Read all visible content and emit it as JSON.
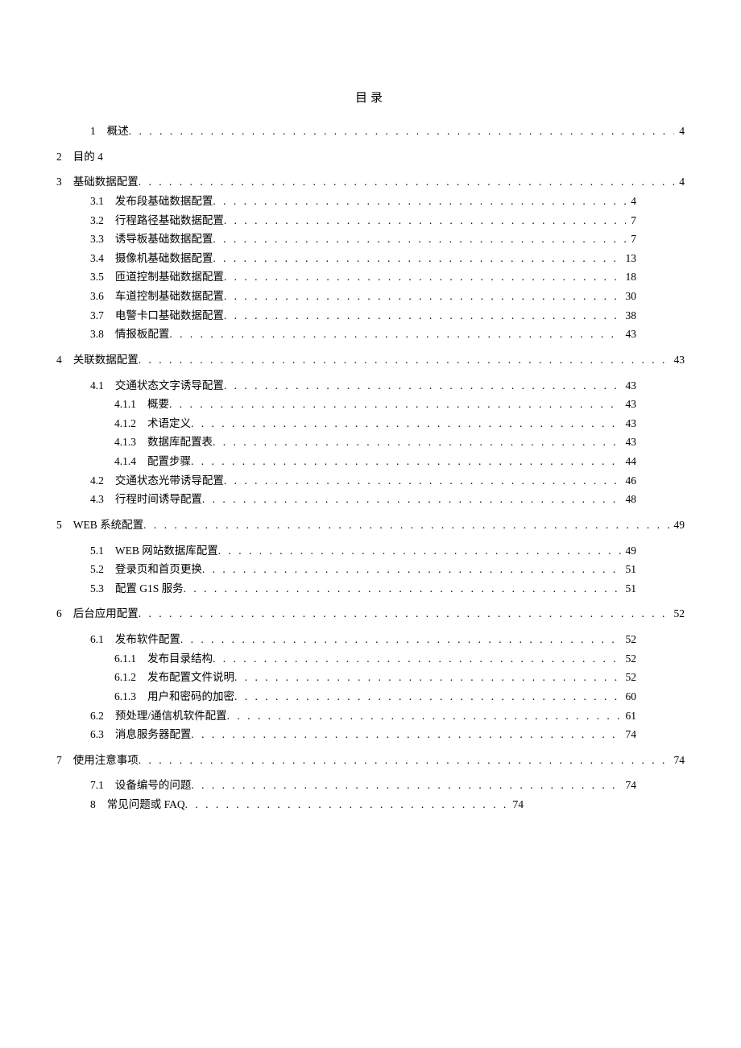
{
  "title": "目录",
  "toc": [
    {
      "num": "1",
      "text": "概述",
      "page": "4",
      "indent": 1,
      "rmargin": 0
    },
    {
      "num": "2",
      "text": "目的 4",
      "page": "",
      "indent": 0,
      "rmargin": 0,
      "nodots": true,
      "spacer_before": true
    },
    {
      "num": "3",
      "text": "基础数据配置",
      "page": "4",
      "indent": 0,
      "rmargin": 0,
      "spacer_before": true
    },
    {
      "num": "3.1",
      "text": "发布段基础数据配置",
      "page": "4",
      "indent": 2,
      "rmargin": 60
    },
    {
      "num": "3.2",
      "text": "行程路径基础数据配置",
      "page": "7",
      "indent": 2,
      "rmargin": 60
    },
    {
      "num": "3.3",
      "text": "诱导板基础数据配置",
      "page": "7",
      "indent": 2,
      "rmargin": 60
    },
    {
      "num": "3.4",
      "text": "摄像机基础数据配置",
      "page": "13",
      "indent": 2,
      "rmargin": 60
    },
    {
      "num": "3.5",
      "text": "匝道控制基础数据配置",
      "page": "18",
      "indent": 2,
      "rmargin": 60
    },
    {
      "num": "3.6",
      "text": "车道控制基础数据配置",
      "page": "30",
      "indent": 2,
      "rmargin": 60
    },
    {
      "num": "3.7",
      "text": "电警卡口基础数据配置",
      "page": "38",
      "indent": 2,
      "rmargin": 60
    },
    {
      "num": "3.8",
      "text": "情报板配置",
      "page": "43",
      "indent": 2,
      "rmargin": 60
    },
    {
      "num": "4",
      "text": "关联数据配置",
      "page": "43",
      "indent": 0,
      "rmargin": 0,
      "spacer_before": true
    },
    {
      "num": "4.1",
      "text": "交通状态文字诱导配置",
      "page": "43",
      "indent": 2,
      "rmargin": 60,
      "spacer_before": true
    },
    {
      "num": "4.1.1",
      "text": "概要",
      "page": "43",
      "indent": 3,
      "rmargin": 60
    },
    {
      "num": "4.1.2",
      "text": "术语定义",
      "page": "43",
      "indent": 3,
      "rmargin": 60
    },
    {
      "num": "4.1.3",
      "text": "数据库配置表",
      "page": "43",
      "indent": 3,
      "rmargin": 60
    },
    {
      "num": "4.1.4",
      "text": "配置步骤",
      "page": "44",
      "indent": 3,
      "rmargin": 60
    },
    {
      "num": "4.2",
      "text": "交通状态光带诱导配置",
      "page": "46",
      "indent": 2,
      "rmargin": 60
    },
    {
      "num": "4.3",
      "text": "行程时间诱导配置",
      "page": "48",
      "indent": 2,
      "rmargin": 60
    },
    {
      "num": "5",
      "text": "WEB 系统配置",
      "page": "49",
      "indent": 0,
      "rmargin": 0,
      "spacer_before": true
    },
    {
      "num": "5.1",
      "text": "WEB 网站数据库配置",
      "page": "49",
      "indent": 2,
      "rmargin": 60,
      "spacer_before": true
    },
    {
      "num": "5.2",
      "text": "登录页和首页更换",
      "page": "51",
      "indent": 2,
      "rmargin": 60
    },
    {
      "num": "5.3",
      "text": "配置 G1S 服务",
      "page": "51",
      "indent": 2,
      "rmargin": 60
    },
    {
      "num": "6",
      "text": "后台应用配置",
      "page": "52",
      "indent": 0,
      "rmargin": 0,
      "spacer_before": true
    },
    {
      "num": "6.1",
      "text": "发布软件配置",
      "page": "52",
      "indent": 2,
      "rmargin": 60,
      "spacer_before": true
    },
    {
      "num": "6.1.1",
      "text": "发布目录结构",
      "page": "52",
      "indent": 3,
      "rmargin": 60
    },
    {
      "num": "6.1.2",
      "text": "发布配置文件说明",
      "page": "52",
      "indent": 3,
      "rmargin": 60
    },
    {
      "num": "6.1.3",
      "text": "用户和密码的加密",
      "page": "60",
      "indent": 3,
      "rmargin": 60
    },
    {
      "num": "6.2",
      "text": "预处理/通信机软件配置",
      "page": "61",
      "indent": 2,
      "rmargin": 60
    },
    {
      "num": "6.3",
      "text": "消息服务器配置",
      "page": "74",
      "indent": 2,
      "rmargin": 60
    },
    {
      "num": "7",
      "text": "使用注意事项",
      "page": "74",
      "indent": 0,
      "rmargin": 0,
      "spacer_before": true
    },
    {
      "num": "7.1",
      "text": "设备编号的问题",
      "page": "74",
      "indent": 2,
      "rmargin": 60,
      "spacer_before": true
    },
    {
      "num": "8",
      "text": "常见问题或 FAQ",
      "page": "74",
      "indent": 1,
      "rmargin": 200
    }
  ]
}
